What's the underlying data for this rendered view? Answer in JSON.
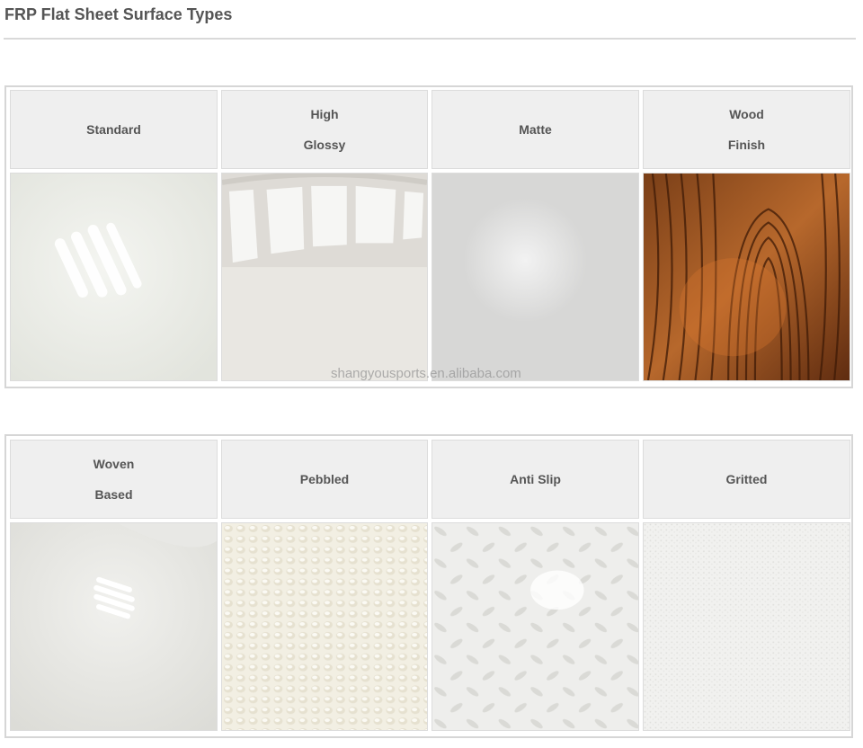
{
  "page": {
    "title": "FRP Flat Sheet Surface Types"
  },
  "watermark": "shangyousports.en.alibaba.com",
  "grids": [
    {
      "cells": [
        {
          "lines": [
            "Standard"
          ],
          "texture": "standard-gloss-icon"
        },
        {
          "lines": [
            "High",
            "Glossy"
          ],
          "texture": "high-glossy-reflection-icon"
        },
        {
          "lines": [
            "Matte"
          ],
          "texture": "matte-surface-icon"
        },
        {
          "lines": [
            "Wood",
            "Finish"
          ],
          "texture": "wood-grain-icon"
        }
      ]
    },
    {
      "cells": [
        {
          "lines": [
            "Woven",
            "Based"
          ],
          "texture": "woven-surface-icon"
        },
        {
          "lines": [
            "Pebbled"
          ],
          "texture": "pebbled-surface-icon"
        },
        {
          "lines": [
            "Anti Slip"
          ],
          "texture": "anti-slip-pattern-icon"
        },
        {
          "lines": [
            "Gritted"
          ],
          "texture": "gritted-surface-icon"
        }
      ]
    }
  ],
  "colors": {
    "header_bg": "#efefef",
    "border": "#d6d6d6",
    "text": "#555555",
    "wood_dark": "#6b3414",
    "wood_light": "#c87a3a"
  }
}
